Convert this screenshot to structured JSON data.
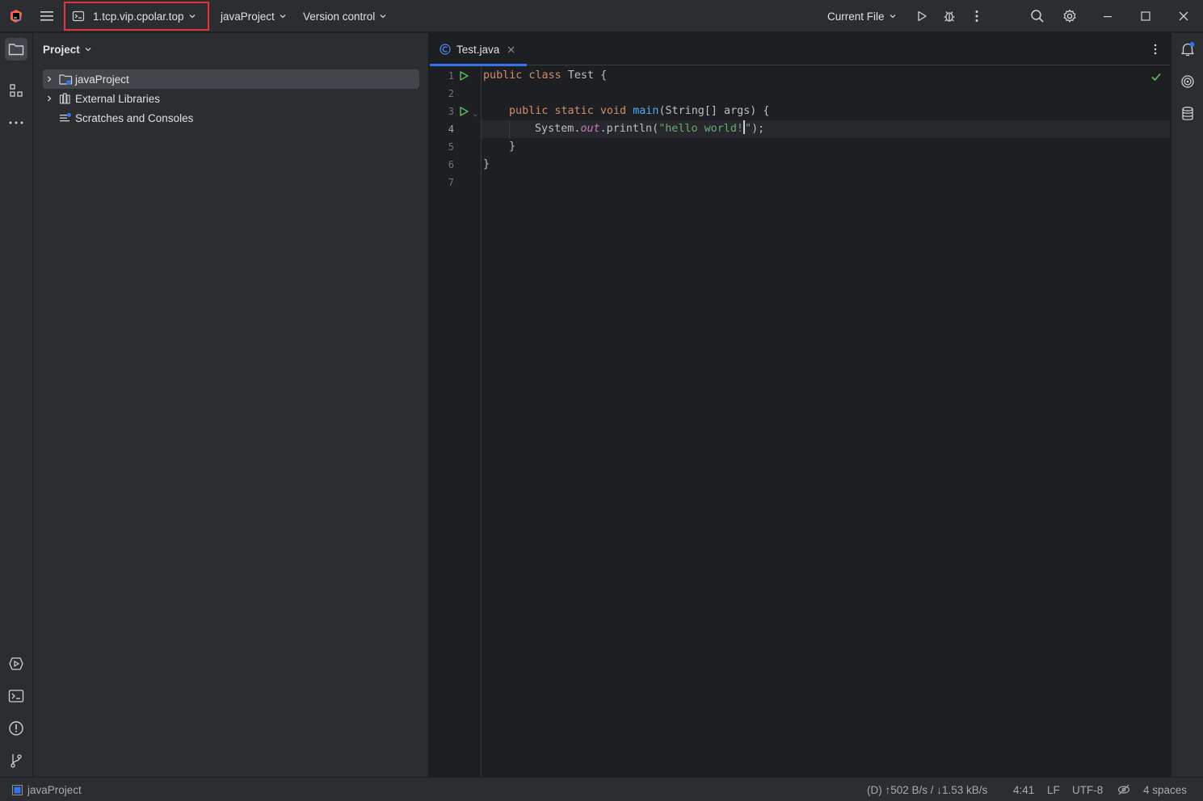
{
  "titlebar": {
    "remote_host": "1.tcp.vip.cpolar.top",
    "project_name": "javaProject",
    "vcs_label": "Version control",
    "run_config": "Current File"
  },
  "project_panel": {
    "title": "Project",
    "items": [
      {
        "label": "javaProject",
        "icon": "folder-module-icon",
        "expandable": true,
        "selected": true
      },
      {
        "label": "External Libraries",
        "icon": "library-icon",
        "expandable": true,
        "selected": false
      },
      {
        "label": "Scratches and Consoles",
        "icon": "scratches-icon",
        "expandable": false,
        "selected": false
      }
    ]
  },
  "editor": {
    "tab": {
      "label": "Test.java",
      "icon": "java-class-icon"
    },
    "current_line": 4,
    "lines": [
      {
        "n": "1"
      },
      {
        "n": "2"
      },
      {
        "n": "3"
      },
      {
        "n": "4"
      },
      {
        "n": "5"
      },
      {
        "n": "6"
      },
      {
        "n": "7"
      }
    ],
    "code": {
      "l1_kw": "public class ",
      "l1_rest": "Test {",
      "l3_kw": "public static void ",
      "l3_fn": "main",
      "l3_rest": "(String[] args) {",
      "l4_a": "System.",
      "l4_field": "out",
      "l4_b": ".println(",
      "l4_str_a": "\"hello world!",
      "l4_str_b": "\"",
      "l4_c": ");",
      "l5": "}",
      "l6": "}"
    }
  },
  "statusbar": {
    "project": "javaProject",
    "network": "(D) ↑502 B/s / ↓1.53 kB/s",
    "position": "4:41",
    "line_sep": "LF",
    "encoding": "UTF-8",
    "indent": "4 spaces"
  },
  "colors": {
    "accent": "#3574f0",
    "highlight_border": "#e0353a",
    "run_green": "#5fb865",
    "check_green": "#5fb865"
  }
}
